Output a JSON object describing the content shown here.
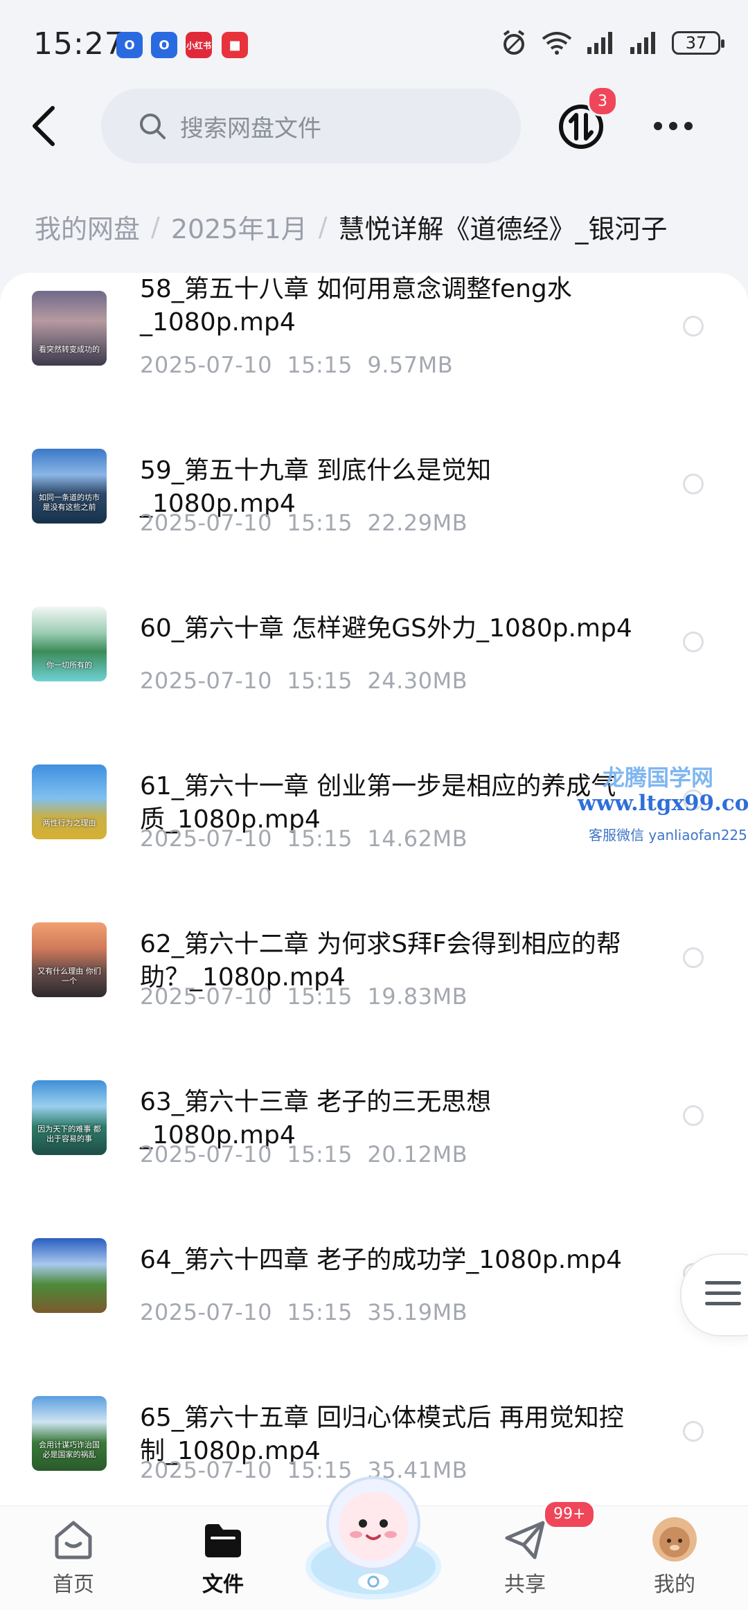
{
  "status": {
    "time": "15:27",
    "notifications": [
      "O",
      "O",
      "小红书",
      "■"
    ],
    "battery": "37"
  },
  "header": {
    "search_placeholder": "搜索网盘文件",
    "transfer_badge": "3"
  },
  "breadcrumb": [
    "我的网盘",
    "2025年1月",
    "慧悦详解《道德经》_银河子"
  ],
  "files": [
    {
      "title": "58_第五十八章 如何用意念调整feng水_1080p.mp4",
      "date": "2025-07-10",
      "time": "15:15",
      "size": "9.57MB",
      "thumb_caption": "看突然转变成功的"
    },
    {
      "title": "59_第五十九章 到底什么是觉知_1080p.mp4",
      "date": "2025-07-10",
      "time": "15:15",
      "size": "22.29MB",
      "thumb_caption": "如同一条道的坊市 是没有这些之前"
    },
    {
      "title": "60_第六十章 怎样避免GS外力_1080p.mp4",
      "date": "2025-07-10",
      "time": "15:15",
      "size": "24.30MB",
      "thumb_caption": "你一切所有的"
    },
    {
      "title": "61_第六十一章 创业第一步是相应的养成气质_1080p.mp4",
      "date": "2025-07-10",
      "time": "15:15",
      "size": "14.62MB",
      "thumb_caption": "两性行为之理由"
    },
    {
      "title": "62_第六十二章 为何求S拜F会得到相应的帮助？_1080p.mp4",
      "date": "2025-07-10",
      "time": "15:15",
      "size": "19.83MB",
      "thumb_caption": "又有什么理由 你们一个"
    },
    {
      "title": "63_第六十三章  老子的三无思想_1080p.mp4",
      "date": "2025-07-10",
      "time": "15:15",
      "size": "20.12MB",
      "thumb_caption": "因为天下的难事 都出于容易的事"
    },
    {
      "title": "64_第六十四章 老子的成功学_1080p.mp4",
      "date": "2025-07-10",
      "time": "15:15",
      "size": "35.19MB",
      "thumb_caption": ""
    },
    {
      "title": "65_第六十五章 回归心体模式后 再用觉知控制_1080p.mp4",
      "date": "2025-07-10",
      "time": "15:15",
      "size": "35.41MB",
      "thumb_caption": "会用计谋巧诈治国 必是国家的祸乱"
    }
  ],
  "watermark": {
    "line1": "龙腾国学网",
    "line2": "www.ltgx99.com",
    "line3": "客服微信 yanliaofan225"
  },
  "nav": {
    "home": "首页",
    "files": "文件",
    "share": "共享",
    "share_badge": "99+",
    "me": "我的"
  },
  "colors": {
    "accent_badge": "#f0465a",
    "background": "#f3f4f7",
    "meta_text": "#a4a8b0"
  }
}
